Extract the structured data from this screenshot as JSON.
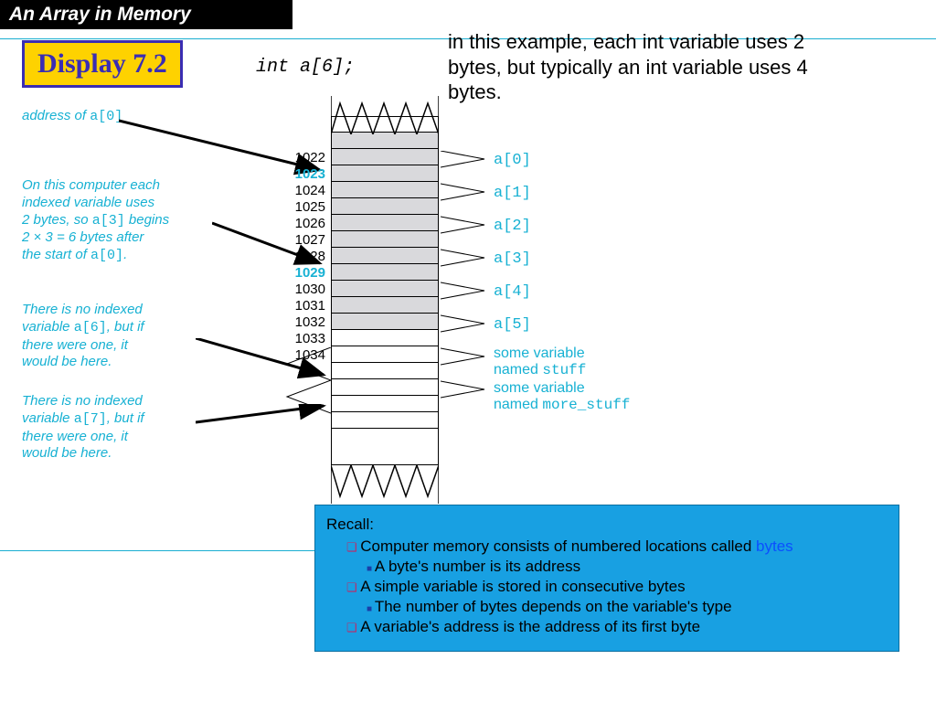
{
  "title": "An Array in Memory",
  "badge": "Display 7.2",
  "declaration": "int a[6];",
  "caption": "in this example, each int variable uses 2 bytes, but typically an int variable uses 4 bytes.",
  "notes": {
    "addr0_pre": "address of ",
    "addr0_code": "a[0]",
    "twobytes_l1": "On this computer each",
    "twobytes_l2": "indexed variable uses",
    "twobytes_l3a": "2 bytes, so ",
    "twobytes_l3b": "a[3]",
    "twobytes_l3c": " begins",
    "twobytes_l4": "2 × 3 = 6 bytes after",
    "twobytes_l5a": "the start of ",
    "twobytes_l5b": "a[0]",
    "twobytes_l5c": ".",
    "a6_l1": "There is no indexed",
    "a6_l2a": "variable ",
    "a6_l2b": "a[6]",
    "a6_l2c": ", but if",
    "a6_l3": "there were one, it",
    "a6_l4": "would be here.",
    "a7_l1": "There is no indexed",
    "a7_l2a": "variable ",
    "a7_l2b": "a[7]",
    "a7_l2c": ", but if",
    "a7_l3": "there were one, it",
    "a7_l4": "would be here."
  },
  "addresses": [
    "1022",
    "1023",
    "1024",
    "1025",
    "1026",
    "1027",
    "1028",
    "1029",
    "1030",
    "1031",
    "1032",
    "1033",
    "1034"
  ],
  "addr_highlight": {
    "1023": true,
    "1029": true
  },
  "right_items": [
    "a[0]",
    "a[1]",
    "a[2]",
    "a[3]",
    "a[4]",
    "a[5]"
  ],
  "right_text": {
    "sv1a": "some variable",
    "sv1b": "named ",
    "sv1b_code": "stuff",
    "sv2a": "some variable",
    "sv2b": "named ",
    "sv2b_code": "more_stuff"
  },
  "recall": {
    "hdr": "Recall:",
    "b1a": "Computer memory consists of numbered locations called ",
    "b1b": "bytes",
    "b1s": "A byte's number is its address",
    "b2": "A simple variable is stored in consecutive bytes",
    "b2s": "The number of bytes depends on the variable's type",
    "b3": "A variable's address is the address of its first byte"
  }
}
